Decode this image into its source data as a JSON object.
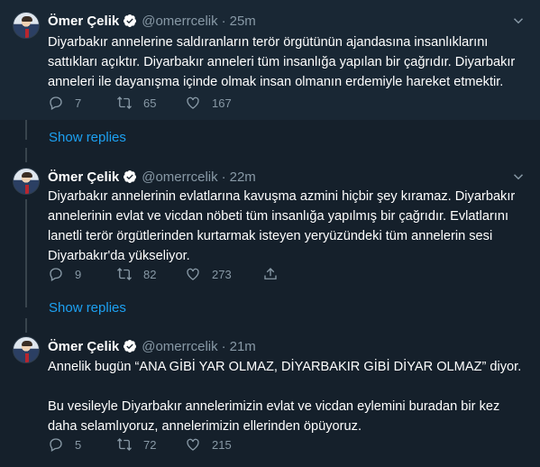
{
  "theme": {
    "background": "#15202b",
    "highlight": "#192734",
    "muted": "#8899a6",
    "accent": "#1da1f2"
  },
  "tweets": [
    {
      "name": "Ömer Çelik",
      "handle": "@omerrcelik",
      "separator": "·",
      "time": "25m",
      "text": "Diyarbakır annelerine saldıranların terör örgütünün ajandasına insanlıklarını\nsattıkları açıktır. Diyarbakır anneleri tüm insanlığa yapılan bir çağrıdır. Diyarbakır\nanneleri ile dayanışma içinde olmak insan olmanın erdemiyle hareket etmektir.",
      "replies": "7",
      "retweets": "65",
      "likes": "167"
    },
    {
      "name": "Ömer Çelik",
      "handle": "@omerrcelik",
      "separator": "·",
      "time": "22m",
      "text": "Diyarbakır annelerinin evlatlarına kavuşma azmini hiçbir şey kıramaz. Diyarbakır\nannelerinin evlat ve vicdan nöbeti tüm insanlığa yapılmış bir çağrıdır. Evlatlarını\nlanetli terör örgütlerinden kurtarmak isteyen yeryüzündeki tüm annelerin sesi\nDiyarbakır'da yükseliyor.",
      "replies": "9",
      "retweets": "82",
      "likes": "273"
    },
    {
      "name": "Ömer Çelik",
      "handle": "@omerrcelik",
      "separator": "·",
      "time": "21m",
      "text": "Annelik bugün “ANA GİBİ YAR OLMAZ, DİYARBAKIR GİBİ DİYAR OLMAZ” diyor.\n\nBu vesileyle Diyarbakır annelerimizin evlat ve vicdan eylemini buradan bir kez\ndaha selamlıyoruz, annelerimizin ellerinden öpüyoruz.",
      "replies": "5",
      "retweets": "72",
      "likes": "215"
    }
  ],
  "show_replies": [
    "Show replies",
    "Show replies"
  ],
  "icons": {
    "verified": "verified-badge-icon",
    "caret": "chevron-down-icon",
    "reply": "reply-icon",
    "retweet": "retweet-icon",
    "like": "heart-icon"
  }
}
